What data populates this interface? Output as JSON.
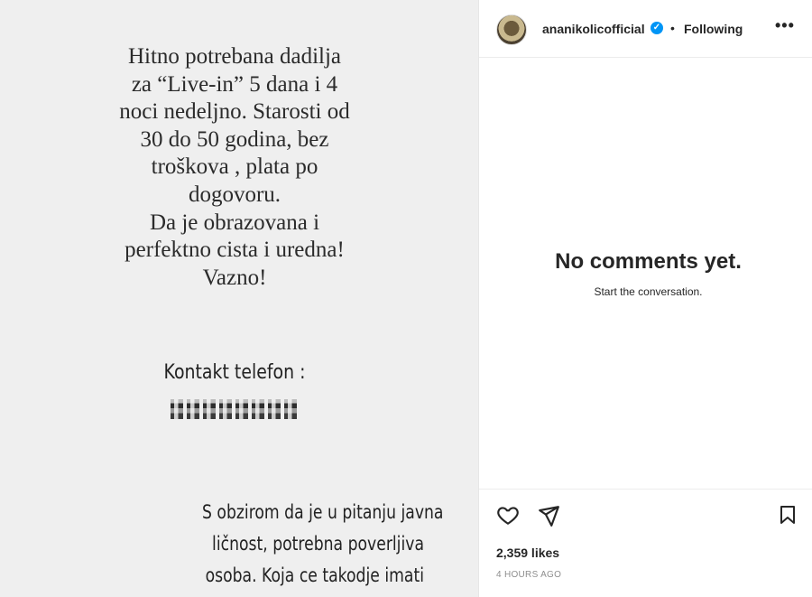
{
  "post": {
    "ad_lines": [
      "Hitno potrebana dadilja",
      "za “Live-in” 5 dana i 4",
      "noci nedeljno. Starosti od",
      "30 do 50 godina, bez",
      "troškova , plata po",
      "dogovoru.",
      "Da je obrazovana i",
      "perfektno cista i uredna!",
      "Vazno!"
    ],
    "contact_label": "Kontakt telefon :",
    "footnote_lines": [
      "S obzirom da je u pitanju javna",
      "ličnost, potrebna poverljiva",
      "osoba. Koja ce takodje imati"
    ]
  },
  "header": {
    "username": "ananikolicofficial",
    "verified_icon": "verified-badge-icon",
    "separator": "•",
    "following_label": "Following",
    "more_label": "•••"
  },
  "comments": {
    "empty_title": "No comments yet.",
    "empty_subtitle": "Start the conversation."
  },
  "footer": {
    "likes": "2,359 likes",
    "time": "4 HOURS AGO"
  },
  "colors": {
    "verified": "#0095f6",
    "image_background": "#efefef"
  }
}
